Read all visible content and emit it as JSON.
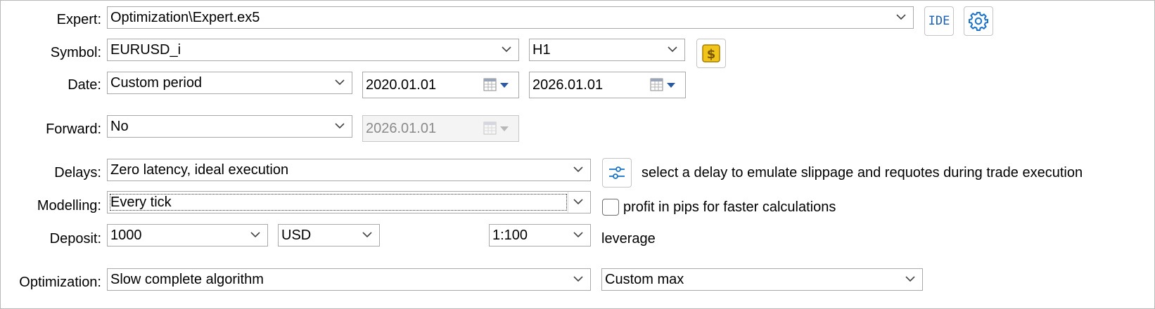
{
  "labels": {
    "expert": "Expert:",
    "symbol": "Symbol:",
    "date": "Date:",
    "forward": "Forward:",
    "delays": "Delays:",
    "modelling": "Modelling:",
    "deposit": "Deposit:",
    "optimization": "Optimization:"
  },
  "expert": {
    "value": "Optimization\\Expert.ex5",
    "ide_label": "IDE"
  },
  "symbol": {
    "value": "EURUSD_i",
    "timeframe": "H1"
  },
  "date": {
    "mode": "Custom period",
    "from": "2020.01.01",
    "to": "2026.01.01"
  },
  "forward": {
    "mode": "No",
    "date": "2026.01.01"
  },
  "delays": {
    "value": "Zero latency, ideal execution",
    "hint": "select a delay to emulate slippage and requotes during trade execution"
  },
  "modelling": {
    "value": "Every tick",
    "pips_label": "profit in pips for faster calculations",
    "pips_checked": false
  },
  "deposit": {
    "amount": "1000",
    "currency": "USD",
    "leverage": "1:100",
    "leverage_label": "leverage"
  },
  "optimization": {
    "algorithm": "Slow complete algorithm",
    "criterion": "Custom max"
  },
  "colors": {
    "accent": "#1a73c9",
    "coin": "#f0c419"
  }
}
